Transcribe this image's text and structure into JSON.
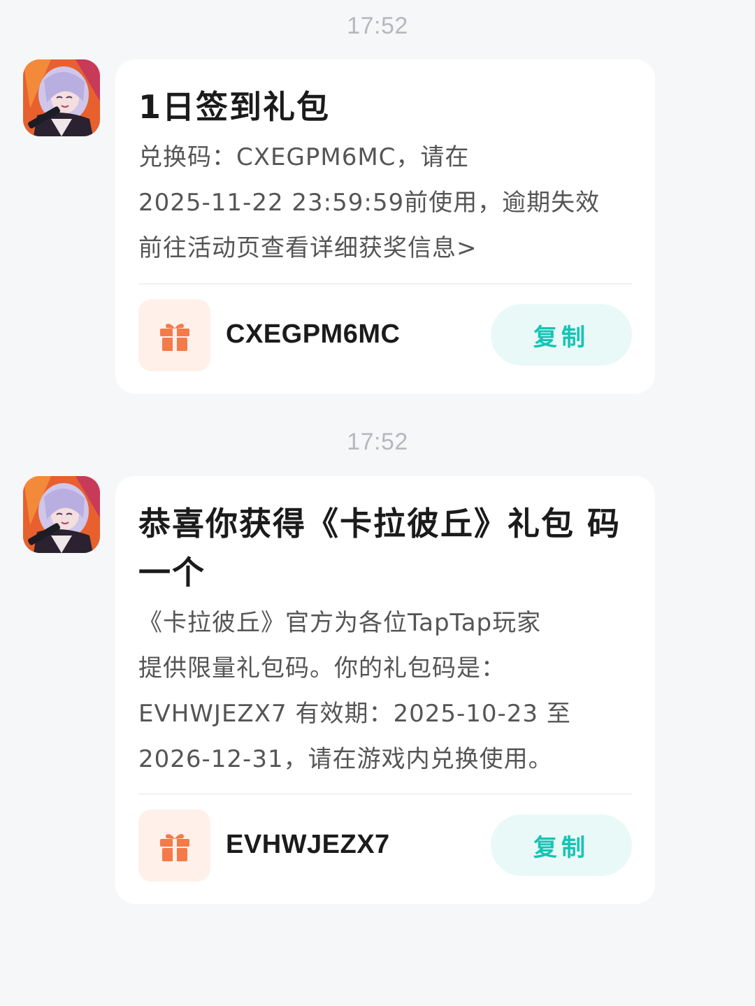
{
  "messages": [
    {
      "time": "17:52",
      "avatar_icon": "game-character-avatar",
      "title_lines": [
        "1日签到礼包"
      ],
      "body_lines": [
        "兑换码：CXEGPM6MC，请在",
        "2025-11-22 23:59:59前使用，逾期失效",
        "前往活动页查看详细获奖信息>"
      ],
      "gift_icon": "gift-icon",
      "code": "CXEGPM6MC",
      "copy_label": "复制"
    },
    {
      "time": "17:52",
      "avatar_icon": "game-character-avatar",
      "title_lines": [
        "恭喜你获得《卡拉彼丘》礼包",
        "码一个"
      ],
      "body_lines": [
        "《卡拉彼丘》官方为各位TapTap玩家",
        "提供限量礼包码。你的礼包码是：",
        "EVHWJEZX7 有效期：2025-10-23 至",
        "2026-12-31，请在游戏内兑换使用。"
      ],
      "gift_icon": "gift-icon",
      "code": "EVHWJEZX7",
      "copy_label": "复制"
    }
  ],
  "colors": {
    "background": "#f6f7f9",
    "card": "#ffffff",
    "accent_teal": "#14c4b4",
    "copy_bg": "#e9f9f7",
    "gift_orange": "#f47a4a",
    "gift_bg": "#fff0ea",
    "timestamp": "#b5b8bd"
  }
}
